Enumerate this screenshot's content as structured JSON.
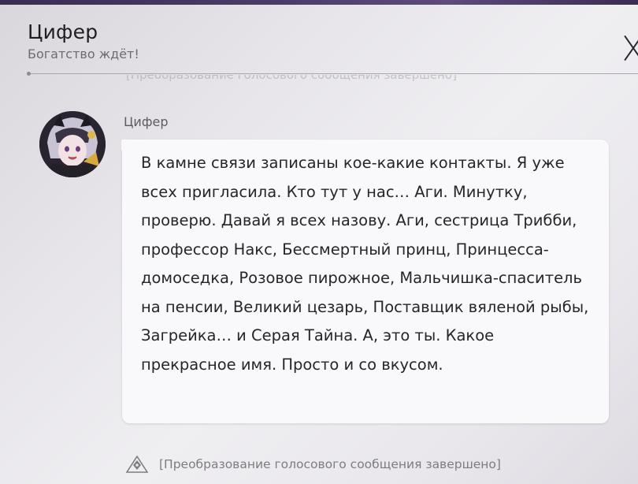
{
  "header": {
    "title": "Цифер",
    "subtitle": "Богатство ждёт!"
  },
  "icons": {
    "close": "close-icon",
    "voice_notice": "voice-note-icon"
  },
  "message": {
    "sender": "Цифер",
    "text": "В камне связи записаны кое-какие контакты. Я уже всех пригласила. Кто тут у нас… Аги. Минутку, проверю. Давай я всех назову. Аги, сестрица Трибби, профессор Накс, Бессмертный принц, Принцесса-домоседка, Розовое пирожное, Мальчишка-спаситель на пенсии, Великий цезарь, Поставщик вяленой рыбы, Загрейка… и Серая Тайна. А, это ты. Какое прекрасное имя. Просто и со вкусом."
  },
  "notices": {
    "previous": "[Преобразование голосового сообщения завершено]",
    "voice_conversion": "[Преобразование голосового сообщения завершено]"
  },
  "colors": {
    "top_band": "#4a3a66",
    "bubble": "#f9f9fb",
    "text": "#26252a",
    "muted": "#7e7c83"
  }
}
